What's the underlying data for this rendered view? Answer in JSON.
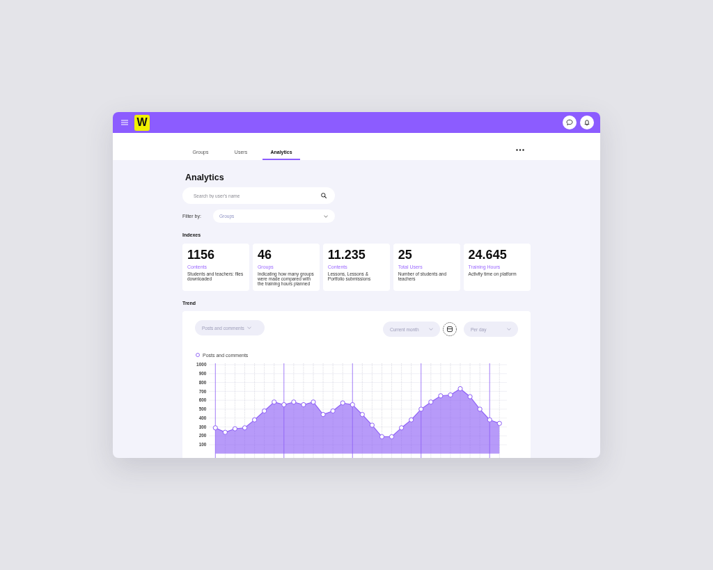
{
  "header": {
    "logo": "W"
  },
  "tabs": [
    {
      "label": "Groups",
      "selected": false
    },
    {
      "label": "Users",
      "selected": false
    },
    {
      "label": "Analytics",
      "selected": true
    }
  ],
  "page": {
    "title": "Analytics",
    "search": {
      "placeholder": "Search by user's name"
    },
    "filter": {
      "label": "Filter by:",
      "value": "Groups"
    }
  },
  "indexes": {
    "title": "Indexes",
    "cards": [
      {
        "value": "1156",
        "label": "Contents",
        "description": "Students and teachers: files downloaded"
      },
      {
        "value": "46",
        "label": "Groups",
        "description": "Indicating how many groups were made compared with the training hours planned"
      },
      {
        "value": "11.235",
        "label": "Contents",
        "description": "Lessons, Lessons & Portfolio submissions"
      },
      {
        "value": "25",
        "label": "Total Users",
        "description": "Number of students and teachers"
      },
      {
        "value": "24.645",
        "label": "Training Hours",
        "description": "Activity time on platform"
      }
    ]
  },
  "trend": {
    "title": "Trend",
    "metric_select": {
      "value": "Posts and comments"
    },
    "period_select": {
      "value": "Current month"
    },
    "interval_select": {
      "value": "Per day"
    },
    "chart_data": {
      "type": "area",
      "series": [
        {
          "name": "Posts and comments",
          "color": "#8b5cf6",
          "values": [
            290,
            240,
            280,
            290,
            380,
            480,
            580,
            550,
            580,
            550,
            580,
            440,
            480,
            570,
            550,
            440,
            320,
            190,
            190,
            290,
            380,
            500,
            580,
            650,
            660,
            730,
            640,
            500,
            380,
            340
          ]
        }
      ],
      "ylim": [
        0,
        1000
      ],
      "yticks": [
        100,
        200,
        300,
        400,
        500,
        600,
        700,
        800,
        900,
        1000
      ],
      "grid": true
    }
  }
}
